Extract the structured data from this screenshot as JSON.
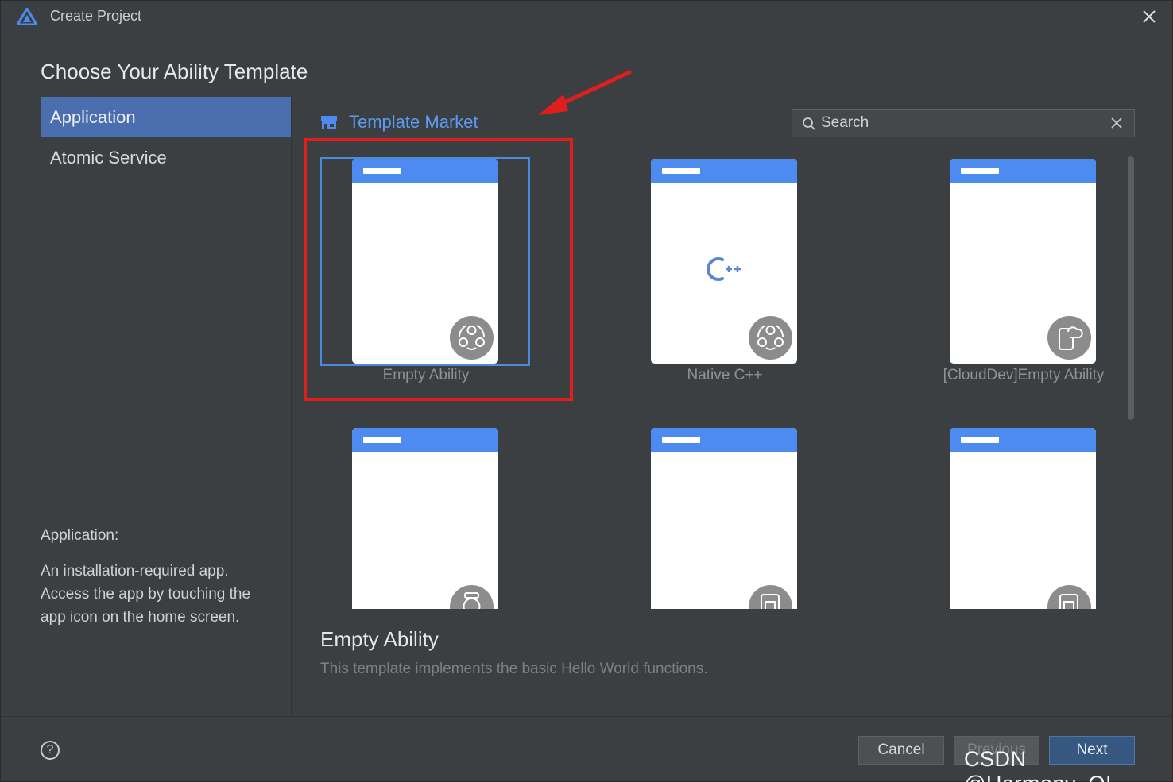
{
  "window": {
    "title": "Create Project",
    "close_icon": "close-icon"
  },
  "page": {
    "heading": "Choose Your Ability Template"
  },
  "sidebar": {
    "items": [
      {
        "label": "Application",
        "selected": true
      },
      {
        "label": "Atomic Service",
        "selected": false
      }
    ],
    "description": {
      "title": "Application:",
      "body": "An installation-required app. Access the app by touching the app icon on the home screen."
    }
  },
  "market": {
    "icon": "store-icon",
    "label": "Template Market"
  },
  "search": {
    "placeholder": "Search",
    "value": ""
  },
  "templates": [
    {
      "label": "Empty Ability",
      "badge": "ability-icon",
      "selected": true
    },
    {
      "label": "Native C++",
      "badge": "ability-icon",
      "center_icon": "cpp-icon",
      "selected": false
    },
    {
      "label": "[CloudDev]Empty Ability",
      "badge": "cloud-phone-icon",
      "selected": false
    },
    {
      "label": "",
      "badge": "watch-icon",
      "selected": false
    },
    {
      "label": "",
      "badge": "card-widget-icon",
      "selected": false
    },
    {
      "label": "",
      "badge": "card-widget-icon",
      "selected": false
    }
  ],
  "detail": {
    "title": "Empty Ability",
    "description": "This template implements the basic Hello World functions."
  },
  "footer": {
    "help_label": "?",
    "cancel_label": "Cancel",
    "previous_label": "Previous",
    "next_label": "Next"
  },
  "annotation": {
    "highlight_color": "#e01e1e"
  },
  "colors": {
    "accent": "#4b6eaf",
    "link": "#5b9bf0",
    "phone_header": "#4d8bf0",
    "background": "#3c3f41"
  },
  "watermark": "CSDN @Harmony_QI"
}
